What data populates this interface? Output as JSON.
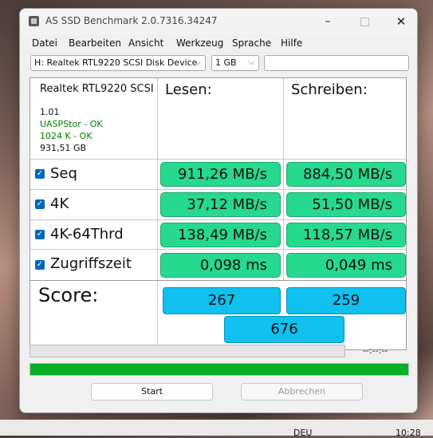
{
  "window": {
    "title": "AS SSD Benchmark 2.0.7316.34247"
  },
  "window_controls": {
    "minimize": "–",
    "maximize": "",
    "close": "✕"
  },
  "menu": [
    "Datei",
    "Bearbeiten",
    "Ansicht",
    "Werkzeug",
    "Sprache",
    "Hilfe"
  ],
  "toolbar": {
    "drive": "H: Realtek RTL9220 SCSI Disk Device",
    "size": "1 GB",
    "chevron": "⌵"
  },
  "device": {
    "name": "Realtek RTL9220 SCSI",
    "version": "1.01",
    "uasp": "UASPStor - OK",
    "align": "1024 K - OK",
    "capacity": "931,51 GB",
    "status_color": "#008000"
  },
  "columns": {
    "read": "Lesen:",
    "write": "Schreiben:"
  },
  "check_mark": "✓",
  "rows": [
    {
      "label": "Seq",
      "read": "911,26 MB/s",
      "write": "884,50 MB/s"
    },
    {
      "label": "4K",
      "read": "37,12 MB/s",
      "write": "51,50 MB/s"
    },
    {
      "label": "4K-64Thrd",
      "read": "138,49 MB/s",
      "write": "118,57 MB/s"
    },
    {
      "label": "Zugriffszeit",
      "read": "0,098 ms",
      "write": "0,049 ms"
    }
  ],
  "score": {
    "label": "Score:",
    "read": "267",
    "write": "259",
    "total": "676"
  },
  "progress": {
    "time": "--:--:--",
    "fill_percent": 100,
    "fill_color": "#06b025"
  },
  "buttons": {
    "start": "Start",
    "abort": "Abbrechen"
  },
  "taskbar": {
    "label": "DEU",
    "time": "10:28"
  },
  "colors": {
    "cell_green": "#27d98e",
    "score_blue": "#10c0ef",
    "accent": "#0067c0"
  }
}
